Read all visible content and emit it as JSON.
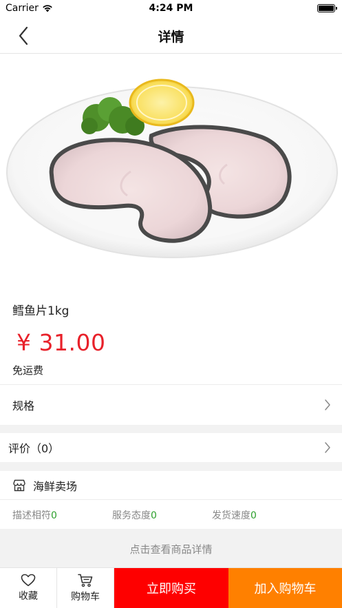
{
  "status_bar": {
    "carrier": "Carrier",
    "time": "4:24 PM"
  },
  "nav": {
    "title": "详情"
  },
  "hero": {
    "image_alt": "cod fish steaks on a white plate with lemon and broccoli"
  },
  "product": {
    "name": "鳕鱼片1kg",
    "price": "¥ 31.00",
    "shipping": "免运费"
  },
  "spec": {
    "label": "规格"
  },
  "reviews": {
    "label": "评价（0）"
  },
  "shop": {
    "name": "海鲜卖场",
    "ratings": [
      {
        "label": "描述相符",
        "value": "0"
      },
      {
        "label": "服务态度",
        "value": "0"
      },
      {
        "label": "发货速度",
        "value": "0"
      }
    ]
  },
  "detail_link": "点击查看商品详情",
  "bottom_bar": {
    "favorite_label": "收藏",
    "cart_label": "购物车",
    "buy_now_label": "立即购买",
    "add_to_cart_label": "加入购物车"
  },
  "colors": {
    "price": "#e8212a",
    "buy_now": "#fe0000",
    "add_to_cart": "#ff8000",
    "rating_value": "#2ea02e"
  }
}
